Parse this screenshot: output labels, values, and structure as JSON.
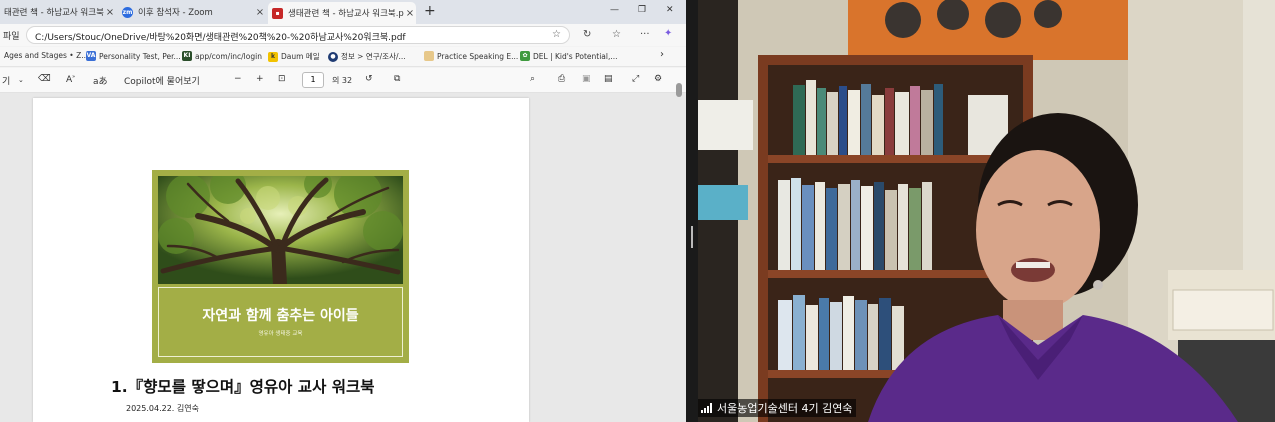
{
  "tabs": [
    {
      "title": "태관련 책 - 하남교사 워크북.pd",
      "favicon_color": "#c62828"
    },
    {
      "title": "이후 참석자 - Zoom",
      "favicon_color": "#2d6cdf",
      "favicon_text": "zm"
    },
    {
      "title": "생태관련 책 - 하남교사 워크북.pd",
      "favicon_color": "#c62828",
      "active": true
    }
  ],
  "address_bar": {
    "left_label": "파일",
    "url": "C:/Users/Stouc/OneDrive/바탕%20화면/생태관련%20책%20-%20하남교사%20워크북.pdf"
  },
  "bookmarks": [
    {
      "label": "Ages and Stages • Z..."
    },
    {
      "label": "Personality Test, Per...",
      "icon_color": "#3a6fd6",
      "icon_text": "VA"
    },
    {
      "label": "app/com/inc/login",
      "icon_color": "#2b4e2b",
      "icon_text": "KI"
    },
    {
      "label": "Daum 메일",
      "icon_color": "#f2c200",
      "icon_text": "k"
    },
    {
      "label": "정보 > 연구/조사/...",
      "icon_color": "#1f3b73",
      "icon_text": "●"
    },
    {
      "label": "Practice Speaking E...",
      "icon_color": "#e7c88a",
      "icon_text": ""
    },
    {
      "label": "DEL | Kid's Potential,...",
      "icon_color": "#3f9a3f",
      "icon_text": "✿"
    }
  ],
  "pdf_toolbar": {
    "copilot_label": "Copilot에 물어보기",
    "page_current": "1",
    "page_total_label": "의 32"
  },
  "document": {
    "cover_title": "자연과 함께 춤추는 아이들",
    "cover_subtitle": "영유아 생태중 교육",
    "title": "1.『향모를 땋으며』영유아 교사 워크북",
    "date_author": "2025.04.22.  김연숙"
  },
  "video": {
    "participant_name": "서울농업기술센터  4기 김연숙"
  },
  "colors": {
    "cover_green": "#a3ae46",
    "tabbar": "#dfe3ea"
  }
}
